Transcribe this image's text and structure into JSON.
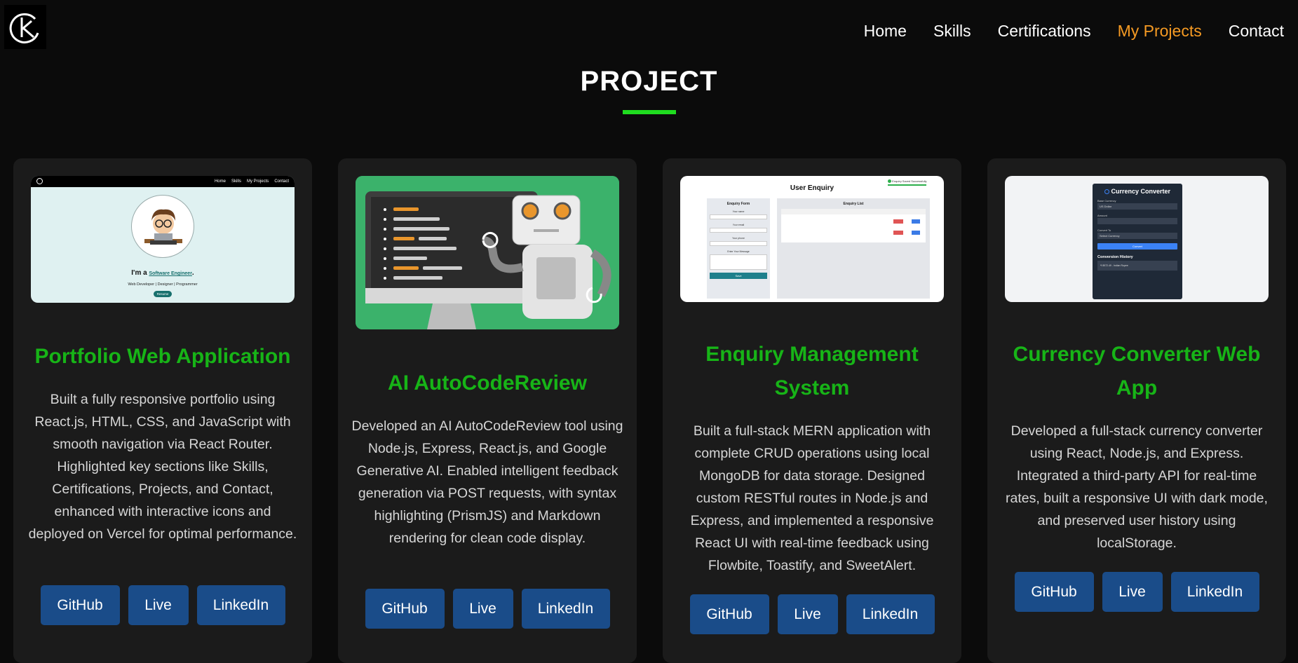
{
  "nav": {
    "items": [
      "Home",
      "Skills",
      "Certifications",
      "My Projects",
      "Contact"
    ],
    "active": "My Projects"
  },
  "section": {
    "title": "PROJECT"
  },
  "projects": [
    {
      "title": "Portfolio Web Application",
      "description": "Built a fully responsive portfolio using React.js, HTML, CSS, and JavaScript with smooth navigation via React Router. Highlighted key sections like Skills, Certifications, Projects, and Contact, enhanced with interactive icons and deployed on Vercel for optimal performance.",
      "buttons": {
        "github": "GitHub",
        "live": "Live",
        "linkedin": "LinkedIn"
      },
      "preview": {
        "nav": [
          "Home",
          "Skills",
          "My Projects",
          "Contact"
        ],
        "headline_prefix": "I'm a",
        "headline_link": "Software Engineer",
        "subtitle": "Web Developer | Designer | Programmer",
        "button": "Resume"
      }
    },
    {
      "title": "AI AutoCodeReview",
      "description": "Developed an AI AutoCodeReview tool using Node.js, Express, React.js, and Google Generative AI. Enabled intelligent feedback generation via POST requests, with syntax highlighting (PrismJS) and Markdown rendering for clean code display.",
      "buttons": {
        "github": "GitHub",
        "live": "Live",
        "linkedin": "LinkedIn"
      }
    },
    {
      "title": "Enquiry Management System",
      "description": "Built a full-stack MERN application with complete CRUD operations using local MongoDB for data storage. Designed custom RESTful routes in Node.js and Express, and implemented a responsive React UI with real-time feedback using Flowbite, Toastify, and SweetAlert.",
      "buttons": {
        "github": "GitHub",
        "live": "Live",
        "linkedin": "LinkedIn"
      },
      "preview": {
        "title": "User Enquiry",
        "toast": "Enquiry Saved Successfully",
        "form_title": "Enquiry Form",
        "list_title": "Enquiry List",
        "save": "Save",
        "labels": [
          "Your name",
          "Your email",
          "Your phone",
          "Enter Your Message"
        ]
      }
    },
    {
      "title": "Currency Converter Web App",
      "description": "Developed a full-stack currency converter using React, Node.js, and Express. Integrated a third-party API for real-time rates, built a responsive UI with dark mode, and preserved user history using localStorage.",
      "buttons": {
        "github": "GitHub",
        "live": "Live",
        "linkedin": "LinkedIn"
      },
      "preview": {
        "title": "Currency Converter",
        "base_label": "Base Currency",
        "base_value": "US Dollar",
        "amount_label": "Amount",
        "convert_label": "Convert To",
        "convert_value": "Select Currency",
        "button": "Convert",
        "history_title": "Conversion History",
        "history_item": "₹ 8572.49 - Indian Rupee"
      }
    }
  ],
  "colors": {
    "background": "#0b0b0b",
    "card": "#1b1b1b",
    "accent_green": "#17b417",
    "title_bar": "#1fdc1f",
    "nav_active": "#f59a23",
    "button": "#1a4c89"
  }
}
